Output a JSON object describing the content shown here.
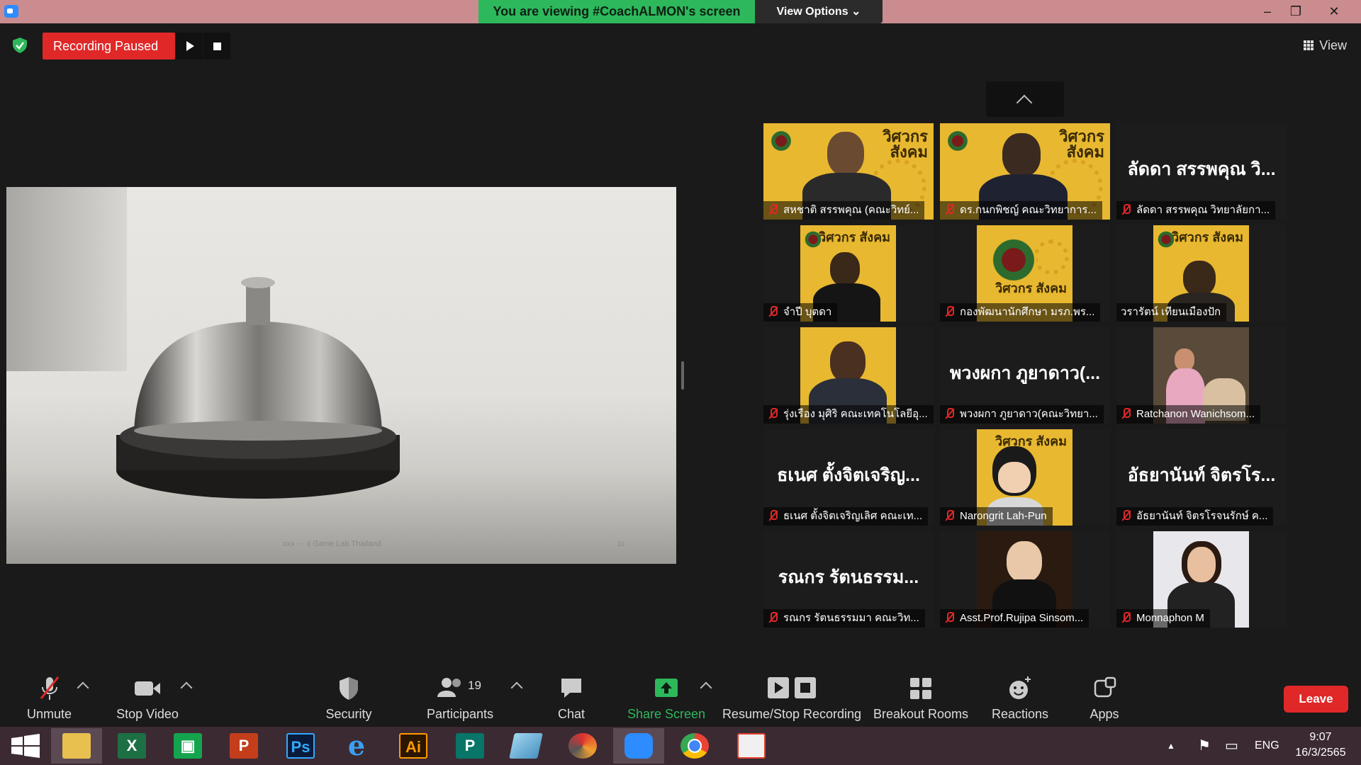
{
  "window": {
    "banner": "You are viewing #CoachALMON's screen",
    "view_options": "View Options ⌄",
    "minimize": "–",
    "restore": "❐",
    "close": "✕"
  },
  "recording": {
    "status": "Recording Paused"
  },
  "view_button": {
    "label": "View"
  },
  "shared_screen": {
    "caption": "xxx ··· x Game Lab Thailand",
    "page": "10"
  },
  "participants": [
    {
      "name": "สหชาติ สรรพคุณ (คณะวิทย์...",
      "muted": true
    },
    {
      "name": "ดร.กนกพิชญ์ คณะวิทยาการ...",
      "muted": true
    },
    {
      "name": "ลัดดา สรรพคุณ วิทยาลัยกา...",
      "display_text": "ลัดดา สรรพคุณ วิ...",
      "muted": true
    },
    {
      "name": "จำปี บุตดา",
      "muted": true
    },
    {
      "name": "กองพัฒนานักศึกษา มรภ.พร...",
      "muted": true
    },
    {
      "name": "วรารัตน์ เทียนเมืองปัก",
      "muted": false
    },
    {
      "name": "รุ่งเรือง มุศิริ คณะเทคโนโลยีอุ...",
      "muted": true
    },
    {
      "name": "พวงผกา ภูยาดาว(คณะวิทยา...",
      "display_text": "พวงผกา ภูยาดาว(...",
      "muted": true
    },
    {
      "name": "Ratchanon Wanichsom...",
      "muted": true
    },
    {
      "name": "ธเนศ ตั้งจิตเจริญเลิศ คณะเท...",
      "display_text": "ธเนศ ตั้งจิตเจริญ...",
      "muted": true
    },
    {
      "name": "Narongrit Lah-Pun",
      "muted": true
    },
    {
      "name": "อัธยานันท์ จิตรโรจนรักษ์ ค...",
      "display_text": "อัธยานันท์ จิตรโร...",
      "muted": true
    },
    {
      "name": "รณกร รัตนธรรมมา คณะวิท...",
      "display_text": "รณกร รัตนธรรม...",
      "muted": true
    },
    {
      "name": "Asst.Prof.Rujipa Sinsom...",
      "muted": true
    },
    {
      "name": "Monnaphon M",
      "muted": true
    }
  ],
  "tile_logo_text": "วิศวกร\nสังคม",
  "toolbar": {
    "unmute": "Unmute",
    "stop_video": "Stop Video",
    "security": "Security",
    "participants": "Participants",
    "participants_count": "19",
    "chat": "Chat",
    "share_screen": "Share Screen",
    "recording": "Resume/Stop Recording",
    "breakout": "Breakout Rooms",
    "reactions": "Reactions",
    "apps": "Apps",
    "leave": "Leave"
  },
  "taskbar": {
    "apps": [
      "Start",
      "File Explorer",
      "Excel",
      "Store",
      "PowerPoint",
      "Photoshop",
      "Internet Explorer",
      "Illustrator",
      "Publisher",
      "Notepad",
      "PhotoScape",
      "Zoom",
      "Chrome",
      "PhotoScape Viewer"
    ],
    "app_glyphs": {
      "excel": "X",
      "store": "▣",
      "powerpoint": "P",
      "photoshop": "Ps",
      "ie": "e",
      "illustrator": "Ai",
      "publisher": "P"
    },
    "lang": "ENG",
    "time": "9:07",
    "date": "16/3/2565"
  },
  "colors": {
    "recording_red": "#e02828",
    "share_green": "#2db85c",
    "tile_yellow": "#e8b830",
    "accent_blue": "#2d8cff"
  }
}
